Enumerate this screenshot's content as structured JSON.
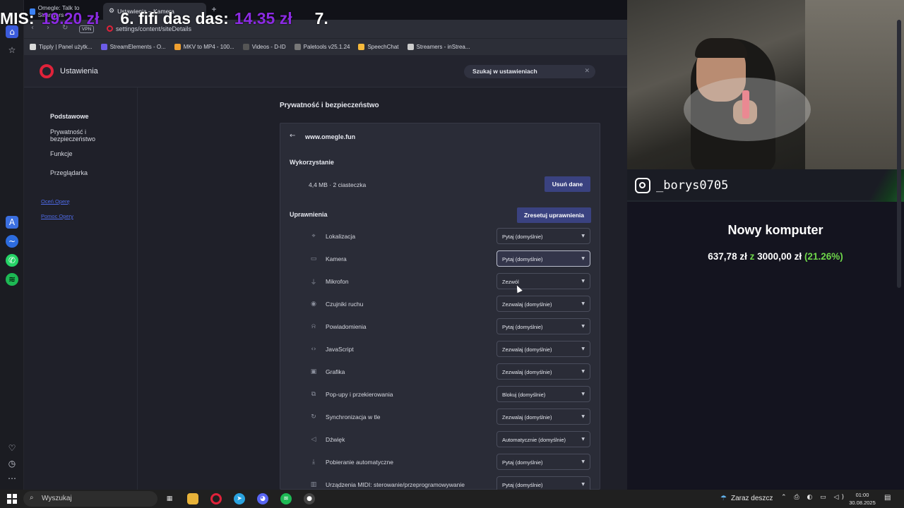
{
  "overlay": {
    "part1": "MIS:",
    "part1_value": "19.20 zł",
    "part2": "6. fifi das das:",
    "part2_value": "14.35 zł",
    "part3": "7."
  },
  "tabs": [
    {
      "label": "Omegle: Talk to Strangers"
    },
    {
      "label": "Ustawienia – Kamera"
    }
  ],
  "address": {
    "vpn": "VPN",
    "url": "settings/content/siteDetails"
  },
  "bookmarks": [
    {
      "label": "Tipply | Panel użytk...",
      "color": "#d9d9d9"
    },
    {
      "label": "StreamElements - O...",
      "color": "#6c5ce7"
    },
    {
      "label": "MKV to MP4 - 100...",
      "color": "#f0a030"
    },
    {
      "label": "Videos - D-ID",
      "color": "#555555"
    },
    {
      "label": "Paletools v25.1.24",
      "color": "#777777"
    },
    {
      "label": "SpeechChat",
      "color": "#f6b93b"
    },
    {
      "label": "Streamers - inStrea...",
      "color": "#cccccc"
    }
  ],
  "settings": {
    "title": "Ustawienia",
    "search": "Szukaj w ustawieniach",
    "nav": [
      {
        "label": "Podstawowe"
      },
      {
        "label": "Prywatność i bezpieczeństwo"
      },
      {
        "label": "Funkcje"
      },
      {
        "label": "Przeglądarka"
      }
    ],
    "links": [
      {
        "label": "Oceń Operę"
      },
      {
        "label": "Pomoc Opery"
      }
    ],
    "section_title": "Prywatność i bezpieczeństwo",
    "site": "www.omegle.fun",
    "usage_heading": "Wykorzystanie",
    "usage_text": "4,4 MB · 2 ciasteczka",
    "clear_button": "Usuń dane",
    "permissions_heading": "Uprawnienia",
    "reset_button": "Zresetuj uprawnienia",
    "permissions": [
      {
        "label": "Lokalizacja",
        "value": "Pytaj (domyślnie)",
        "icon": "location-icon",
        "glyph": "⌖"
      },
      {
        "label": "Kamera",
        "value": "Pytaj (domyślnie)",
        "icon": "camera-icon",
        "glyph": "▭"
      },
      {
        "label": "Mikrofon",
        "value": "Zezwól",
        "icon": "microphone-icon",
        "glyph": "⏚"
      },
      {
        "label": "Czujniki ruchu",
        "value": "Zezwalaj (domyślnie)",
        "icon": "motion-sensor-icon",
        "glyph": "◉"
      },
      {
        "label": "Powiadomienia",
        "value": "Pytaj (domyślnie)",
        "icon": "bell-icon",
        "glyph": "⍾"
      },
      {
        "label": "JavaScript",
        "value": "Zezwalaj (domyślnie)",
        "icon": "code-icon",
        "glyph": "‹›"
      },
      {
        "label": "Grafika",
        "value": "Zezwalaj (domyślnie)",
        "icon": "image-icon",
        "glyph": "▣"
      },
      {
        "label": "Pop-upy i przekierowania",
        "value": "Blokuj (domyślnie)",
        "icon": "popup-icon",
        "glyph": "⧉"
      },
      {
        "label": "Synchronizacja w tle",
        "value": "Zezwalaj (domyślnie)",
        "icon": "sync-icon",
        "glyph": "↻"
      },
      {
        "label": "Dźwięk",
        "value": "Automatycznie (domyślnie)",
        "icon": "sound-icon",
        "glyph": "◁"
      },
      {
        "label": "Pobieranie automatyczne",
        "value": "Pytaj (domyślnie)",
        "icon": "download-icon",
        "glyph": "⤓"
      },
      {
        "label": "Urządzenia MIDI: sterowanie/przeprogramowywanie",
        "value": "Pytaj (domyślnie)",
        "icon": "midi-icon",
        "glyph": "▥"
      }
    ]
  },
  "stream": {
    "instagram": "_borys0705",
    "goal_title": "Nowy komputer",
    "goal_current": "637,78 zł",
    "goal_of": "z",
    "goal_target": "3000,00 zł",
    "goal_percent": "(21.26%)"
  },
  "taskbar": {
    "search": "Wyszukaj",
    "weather": "Zaraz deszcz",
    "time": "01:00",
    "date": "30.08.2025"
  }
}
